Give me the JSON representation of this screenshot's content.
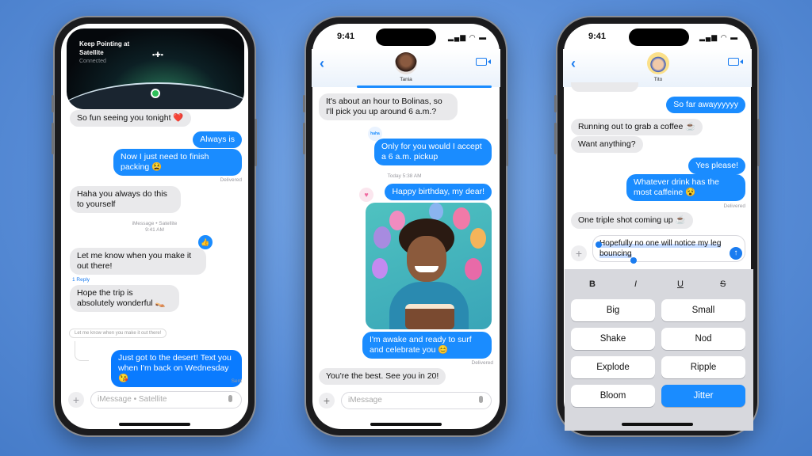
{
  "colors": {
    "accent": "#1a8cff",
    "incoming": "#e9e9eb",
    "background": "#5a8ed8"
  },
  "phone1": {
    "satellite": {
      "title": "Keep Pointing at Satellite",
      "status": "Connected"
    },
    "messages": [
      {
        "from": "them",
        "text": "So fun seeing you tonight ❤️"
      },
      {
        "from": "me",
        "text": "Always is"
      },
      {
        "from": "me",
        "text": "Now I just need to finish packing 😫"
      },
      {
        "from": "them",
        "text": "Haha you always do this to yourself"
      },
      {
        "from": "them",
        "text": "Let me know when you make it out there!",
        "reaction": "👍"
      },
      {
        "from": "them",
        "text": "Hope the trip is absolutely wonderful 👡"
      },
      {
        "from": "me",
        "text": "Just got to the desert! Text you when I'm back on Wednesday 😘"
      }
    ],
    "delivered": "Delivered",
    "service_label": "iMessage • Satellite",
    "service_time": "9:41 AM",
    "reply_count": "1 Reply",
    "quoted": "Let me know when you make it out there!",
    "sent": "Sent",
    "input_placeholder": "iMessage • Satellite"
  },
  "phone2": {
    "time": "9:41",
    "contact": "Tania",
    "messages": [
      {
        "from": "them",
        "text": "It's about an hour to Bolinas, so I'll pick you up around 6 a.m.?"
      },
      {
        "from": "me",
        "text": "Only for you would I accept a 6 a.m. pickup",
        "reaction": "haha"
      },
      {
        "from": "me",
        "text": "Happy birthday, my dear!",
        "reaction": "♥"
      },
      {
        "from": "me",
        "text": "I'm awake and ready to surf and celebrate you 😊"
      },
      {
        "from": "them",
        "text": "You're the best. See you in 20!"
      }
    ],
    "timestamp": "Today 5:38 AM",
    "delivered": "Delivered",
    "input_placeholder": "iMessage"
  },
  "phone3": {
    "time": "9:41",
    "contact": "Tito",
    "messages": [
      {
        "from": "me",
        "text": "So far awayyyyyy"
      },
      {
        "from": "them",
        "text": "Running out to grab a coffee ☕"
      },
      {
        "from": "them",
        "text": "Want anything?"
      },
      {
        "from": "me",
        "text": "Yes please!"
      },
      {
        "from": "me",
        "text": "Whatever drink has the most caffeine 😵"
      },
      {
        "from": "them",
        "text": "One triple shot coming up ☕"
      }
    ],
    "delivered": "Delivered",
    "draft": "Hopefully no one will notice my leg bouncing",
    "format": [
      "B",
      "I",
      "U",
      "S"
    ],
    "effects": [
      "Big",
      "Small",
      "Shake",
      "Nod",
      "Explode",
      "Ripple",
      "Bloom",
      "Jitter"
    ],
    "selected_effect": "Jitter"
  }
}
